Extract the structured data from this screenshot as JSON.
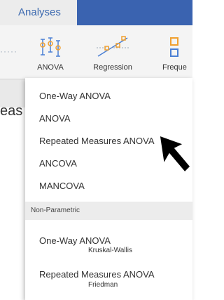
{
  "tabs": {
    "active": "Analyses"
  },
  "ribbon": {
    "left_dots": "·····",
    "buttons": [
      {
        "label": "ANOVA",
        "icon": "anova-icon"
      },
      {
        "label": "Regression",
        "icon": "regression-icon"
      },
      {
        "label": "Freque",
        "icon": "frequencies-icon"
      }
    ]
  },
  "background": {
    "partial_text": "eas"
  },
  "menu": {
    "items": [
      {
        "label": "One-Way ANOVA"
      },
      {
        "label": "ANOVA"
      },
      {
        "label": "Repeated Measures ANOVA"
      },
      {
        "label": "ANCOVA"
      },
      {
        "label": "MANCOVA"
      }
    ],
    "section": "Non-Parametric",
    "nonparam": [
      {
        "label": "One-Way ANOVA",
        "sub": "Kruskal-Wallis"
      },
      {
        "label": "Repeated Measures ANOVA",
        "sub": "Friedman"
      }
    ]
  },
  "colors": {
    "accent": "#3a63b0",
    "icon_blue": "#4a7fd4",
    "icon_orange": "#f0a030"
  }
}
